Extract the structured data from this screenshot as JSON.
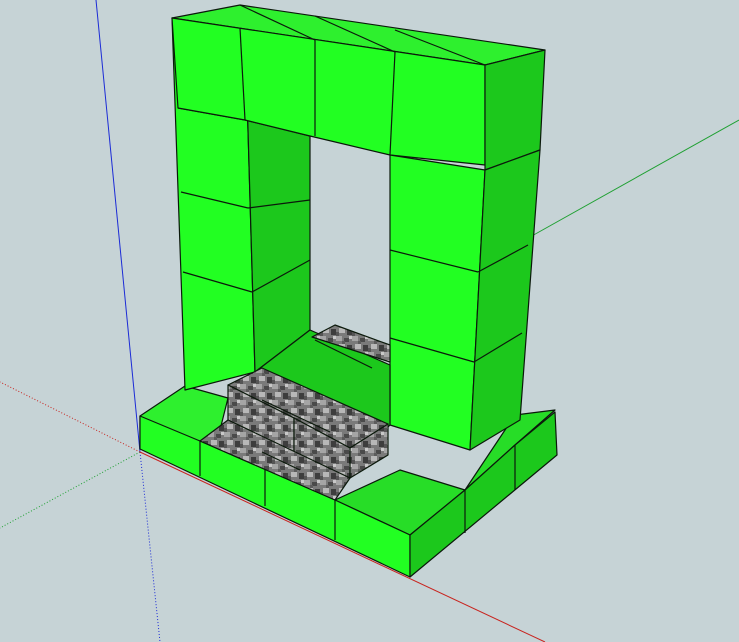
{
  "canvas": {
    "background": "#c6d3d6"
  },
  "axes": {
    "blue_axis_color": "#1c2bd6",
    "green_axis_color": "#1fa032",
    "red_axis_color": "#c8231e"
  },
  "palette": {
    "green_front": "#22ff22",
    "green_top": "#2ef02e",
    "green_side": "#1cc81c",
    "edge": "#0a1a0a",
    "stone_light": "#9a9a9a",
    "stone_dark": "#4a4a4a",
    "stone_mid": "#6e6e6e"
  },
  "model": {
    "description_visible": "",
    "green_block_count_top_beam": 4,
    "green_block_count_left_pillar": 4,
    "green_block_count_right_pillar": 4,
    "stone_block_count": 4
  }
}
